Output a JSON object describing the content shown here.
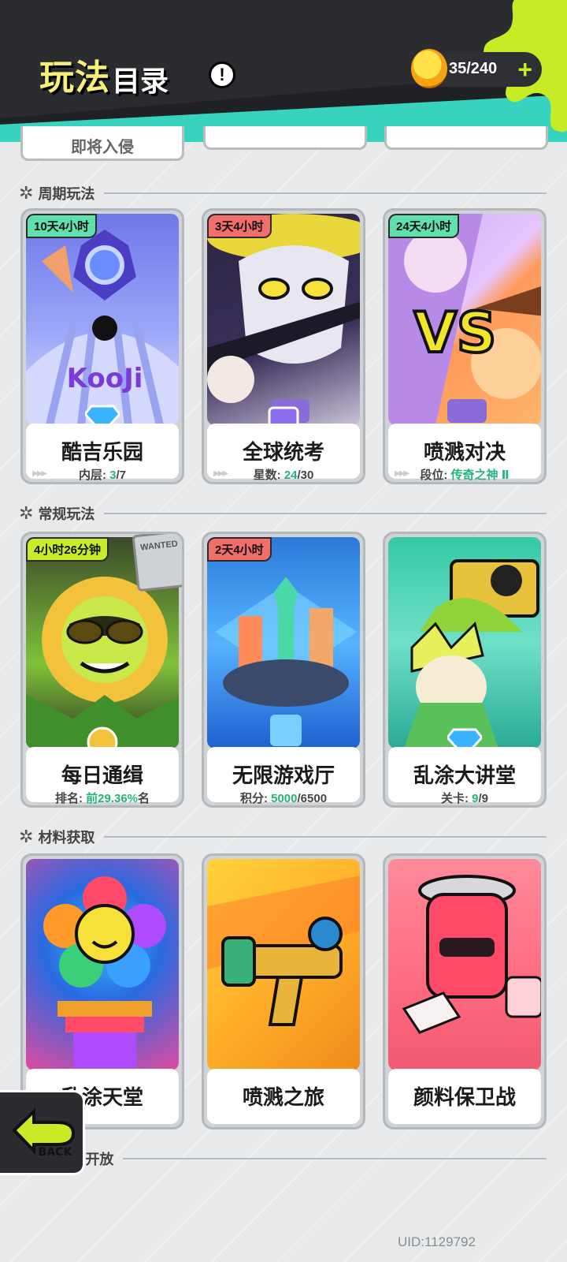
{
  "header": {
    "title_big": "玩法",
    "title_small": "目录",
    "info_icon": "info-icon",
    "currency_value": "35/240",
    "currency_plus": "+"
  },
  "top_row": {
    "label": "即将入侵"
  },
  "sections": {
    "periodic": "周期玩法",
    "regular": "常规玩法",
    "materials": "材料获取",
    "last": "开放"
  },
  "cards": [
    {
      "name": "酷吉乐园",
      "stat_label": "内层: ",
      "stat_value": "3",
      "stat_total": "/7",
      "badge": "10天4小时"
    },
    {
      "name": "全球统考",
      "stat_label": "星数: ",
      "stat_value": "24",
      "stat_total": "/30",
      "badge": "3天4小时"
    },
    {
      "name": "喷溅对决",
      "stat_label": "段位: ",
      "stat_value": "传奇之神 Ⅱ",
      "stat_total": "",
      "badge": "24天4小时"
    },
    {
      "name": "每日通缉",
      "stat_label": "排名: ",
      "stat_value": "前29.36%",
      "stat_total": "名",
      "badge": "4小时26分钟"
    },
    {
      "name": "无限游戏厅",
      "stat_label": "积分: ",
      "stat_value": "5000",
      "stat_total": "/6500",
      "badge": "2天4小时"
    },
    {
      "name": "乱涂大讲堂",
      "stat_label": "关卡: ",
      "stat_value": "9",
      "stat_total": "/9",
      "badge": ""
    },
    {
      "name": "乱涂天堂",
      "stat_label": "",
      "stat_value": "",
      "stat_total": "",
      "badge": ""
    },
    {
      "name": "喷溅之旅",
      "stat_label": "",
      "stat_value": "",
      "stat_total": "",
      "badge": ""
    },
    {
      "name": "颜料保卫战",
      "stat_label": "",
      "stat_value": "",
      "stat_total": "",
      "badge": ""
    }
  ],
  "card_art_labels": {
    "koji": "KooJi",
    "vs": "VS",
    "wanted": "WANTED"
  },
  "back_label": "BACK",
  "uid": "UID:1129792"
}
